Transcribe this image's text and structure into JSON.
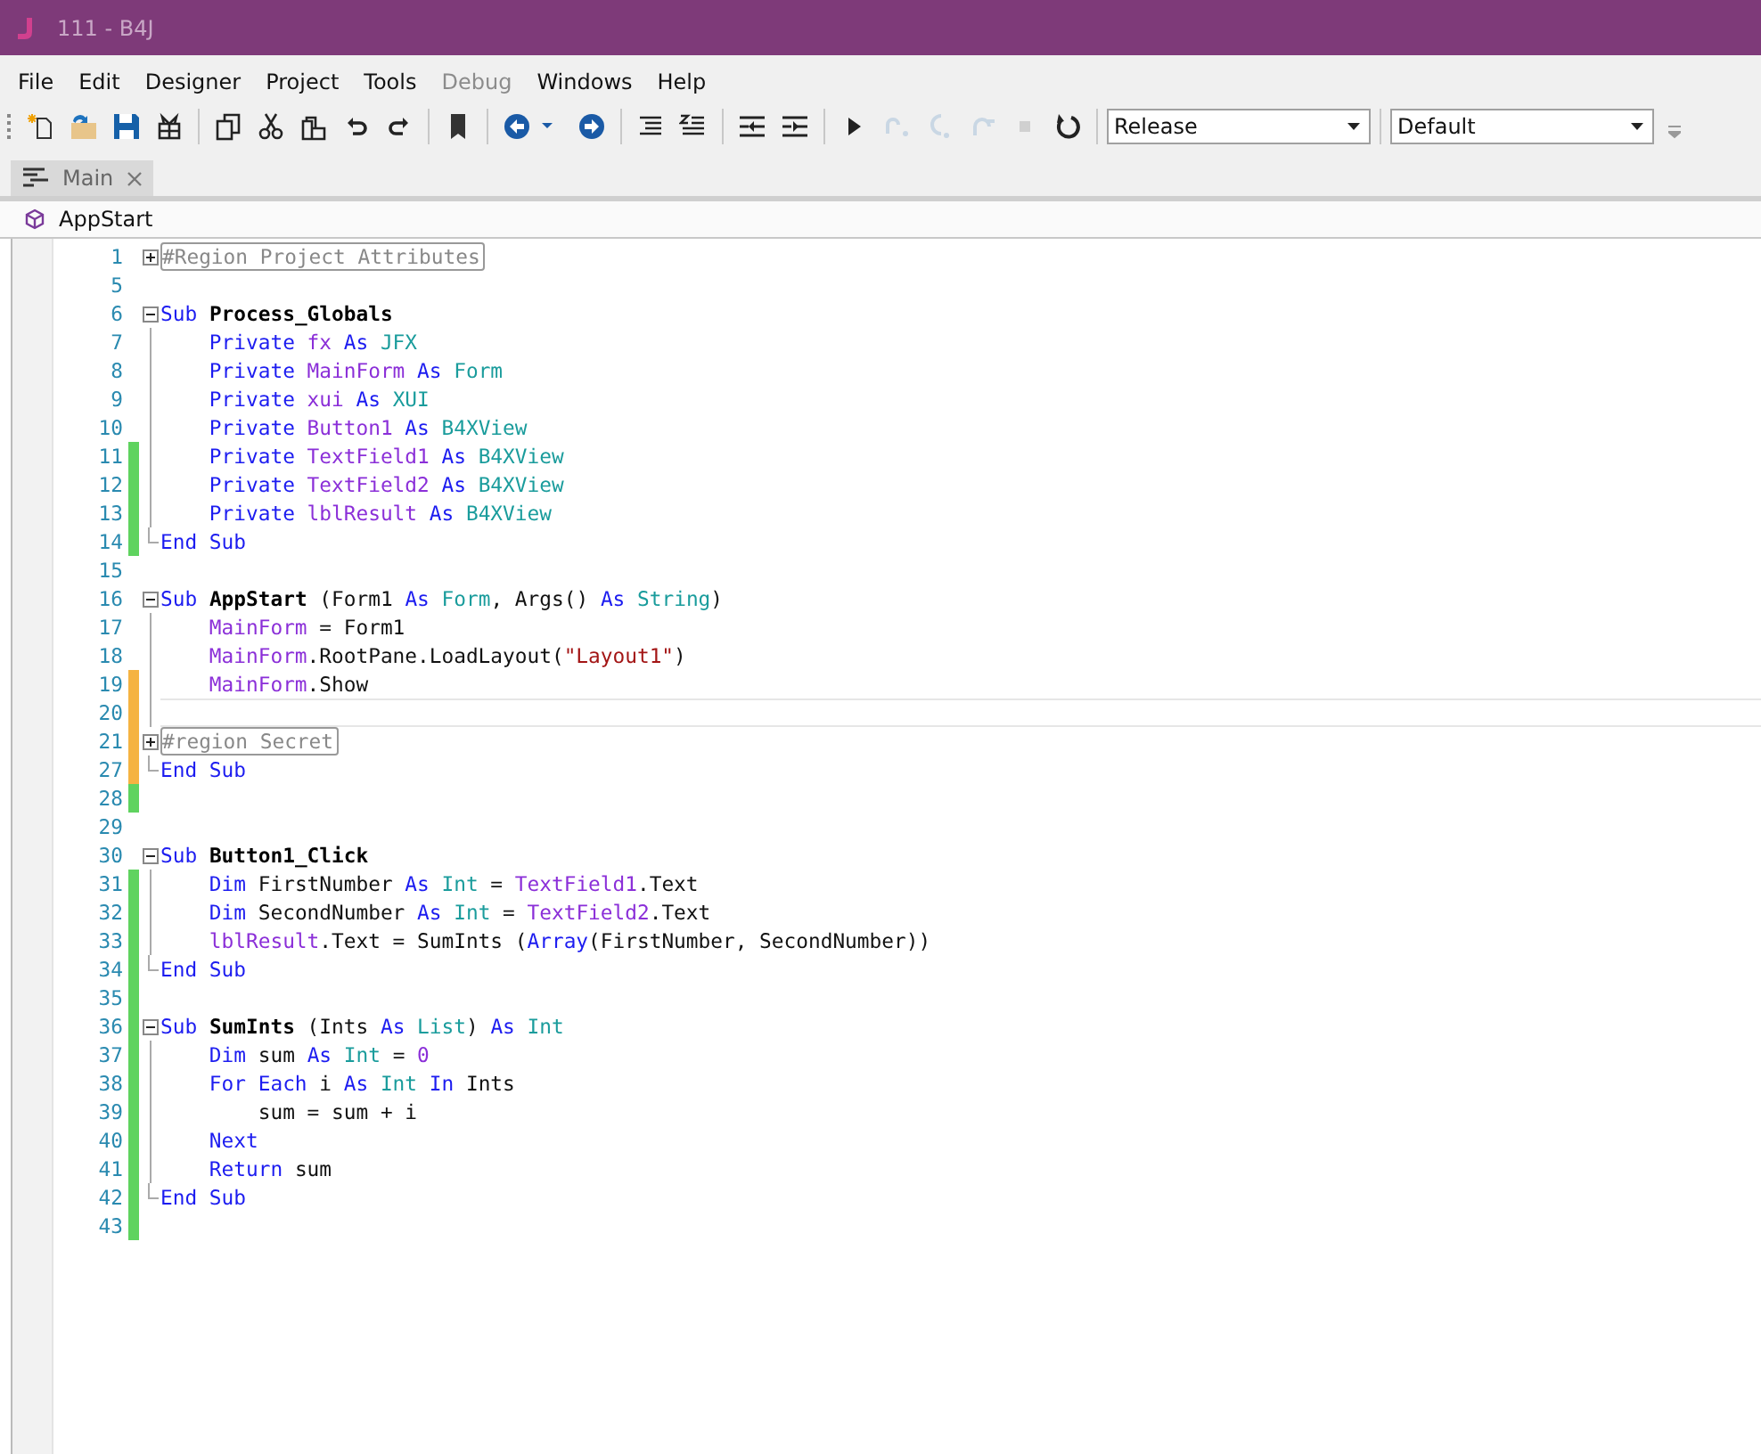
{
  "window": {
    "title": "111 - B4J"
  },
  "menu": [
    {
      "label": "File",
      "disabled": false
    },
    {
      "label": "Edit",
      "disabled": false
    },
    {
      "label": "Designer",
      "disabled": false
    },
    {
      "label": "Project",
      "disabled": false
    },
    {
      "label": "Tools",
      "disabled": false
    },
    {
      "label": "Debug",
      "disabled": true
    },
    {
      "label": "Windows",
      "disabled": false
    },
    {
      "label": "Help",
      "disabled": false
    }
  ],
  "toolbar": [
    {
      "kind": "new",
      "disabled": false
    },
    {
      "kind": "open",
      "disabled": false
    },
    {
      "kind": "save",
      "disabled": false
    },
    {
      "kind": "package",
      "disabled": false
    },
    {
      "kind": "sep"
    },
    {
      "kind": "copy",
      "disabled": false
    },
    {
      "kind": "cut",
      "disabled": false
    },
    {
      "kind": "paste",
      "disabled": false
    },
    {
      "kind": "undo",
      "disabled": false
    },
    {
      "kind": "redo",
      "disabled": false
    },
    {
      "kind": "sep"
    },
    {
      "kind": "bookmark",
      "disabled": false
    },
    {
      "kind": "sep"
    },
    {
      "kind": "back",
      "disabled": false
    },
    {
      "kind": "caret",
      "disabled": false
    },
    {
      "kind": "forward",
      "disabled": false
    },
    {
      "kind": "sep"
    },
    {
      "kind": "lines",
      "disabled": false
    },
    {
      "kind": "comment",
      "disabled": false
    },
    {
      "kind": "sep"
    },
    {
      "kind": "outdent",
      "disabled": false
    },
    {
      "kind": "indent",
      "disabled": false
    },
    {
      "kind": "sep"
    },
    {
      "kind": "run",
      "disabled": false
    },
    {
      "kind": "stepover",
      "disabled": true
    },
    {
      "kind": "stepinto",
      "disabled": true
    },
    {
      "kind": "stepout",
      "disabled": true
    },
    {
      "kind": "stop",
      "disabled": true
    },
    {
      "kind": "restart",
      "disabled": false
    }
  ],
  "selects": [
    {
      "value": "Release"
    },
    {
      "value": "Default"
    }
  ],
  "tabs": [
    {
      "label": "Main",
      "selected": true
    }
  ],
  "module_bar": {
    "label": "AppStart"
  },
  "lines": [
    {
      "n": "1",
      "kind": "closed",
      "current": false,
      "tokens": [
        {
          "kind": "region",
          "text": "#Region Project Attributes"
        }
      ]
    },
    {
      "n": "5",
      "kind": "plain",
      "current": false
    },
    {
      "n": "6",
      "kind": "open",
      "current": false,
      "tokens": [
        {
          "kind": "keyword",
          "text": "Sub "
        },
        {
          "kind": "name",
          "text": "Process_Globals"
        }
      ]
    },
    {
      "n": "7",
      "kind": "inside",
      "current": false,
      "tokens": [
        {
          "kind": "keyword",
          "text": "    Private "
        },
        {
          "kind": "variable",
          "text": "fx"
        },
        {
          "kind": "keyword",
          "text": " As "
        },
        {
          "kind": "type",
          "text": "JFX"
        }
      ]
    },
    {
      "n": "8",
      "kind": "inside",
      "current": false,
      "tokens": [
        {
          "kind": "keyword",
          "text": "    Private "
        },
        {
          "kind": "variable",
          "text": "MainForm"
        },
        {
          "kind": "keyword",
          "text": " As "
        },
        {
          "kind": "type",
          "text": "Form"
        }
      ]
    },
    {
      "n": "9",
      "kind": "inside",
      "current": false,
      "tokens": [
        {
          "kind": "keyword",
          "text": "    Private "
        },
        {
          "kind": "variable",
          "text": "xui"
        },
        {
          "kind": "keyword",
          "text": " As "
        },
        {
          "kind": "type",
          "text": "XUI"
        }
      ]
    },
    {
      "n": "10",
      "kind": "inside",
      "current": false,
      "tokens": [
        {
          "kind": "keyword",
          "text": "    Private "
        },
        {
          "kind": "variable",
          "text": "Button1"
        },
        {
          "kind": "keyword",
          "text": " As "
        },
        {
          "kind": "type",
          "text": "B4XView"
        }
      ]
    },
    {
      "n": "11",
      "kind": "inside",
      "color": "#5fd35f",
      "current": false,
      "tokens": [
        {
          "kind": "keyword",
          "text": "    Private "
        },
        {
          "kind": "variable",
          "text": "TextField1"
        },
        {
          "kind": "keyword",
          "text": " As "
        },
        {
          "kind": "type",
          "text": "B4XView"
        }
      ]
    },
    {
      "n": "12",
      "kind": "inside",
      "color": "#5fd35f",
      "current": false,
      "tokens": [
        {
          "kind": "keyword",
          "text": "    Private "
        },
        {
          "kind": "variable",
          "text": "TextField2"
        },
        {
          "kind": "keyword",
          "text": " As "
        },
        {
          "kind": "type",
          "text": "B4XView"
        }
      ]
    },
    {
      "n": "13",
      "kind": "inside",
      "color": "#5fd35f",
      "current": false,
      "tokens": [
        {
          "kind": "keyword",
          "text": "    Private "
        },
        {
          "kind": "variable",
          "text": "lblResult"
        },
        {
          "kind": "keyword",
          "text": " As "
        },
        {
          "kind": "type",
          "text": "B4XView"
        }
      ]
    },
    {
      "n": "14",
      "kind": "end",
      "color": "#5fd35f",
      "current": false,
      "tokens": [
        {
          "kind": "keyword",
          "text": "End Sub"
        }
      ]
    },
    {
      "n": "15",
      "kind": "plain",
      "current": false
    },
    {
      "n": "16",
      "kind": "open",
      "current": false,
      "tokens": [
        {
          "kind": "keyword",
          "text": "Sub "
        },
        {
          "kind": "name",
          "text": "AppStart"
        },
        {
          "kind": "plain",
          "text": " (Form1 "
        },
        {
          "kind": "keyword",
          "text": "As "
        },
        {
          "kind": "type",
          "text": "Form"
        },
        {
          "kind": "plain",
          "text": ", Args() "
        },
        {
          "kind": "keyword",
          "text": "As "
        },
        {
          "kind": "type",
          "text": "String"
        },
        {
          "kind": "plain",
          "text": ")"
        }
      ]
    },
    {
      "n": "17",
      "kind": "inside",
      "current": false,
      "tokens": [
        {
          "kind": "variable",
          "text": "    MainForm"
        },
        {
          "kind": "plain",
          "text": " = Form1"
        }
      ]
    },
    {
      "n": "18",
      "kind": "inside",
      "current": false,
      "tokens": [
        {
          "kind": "variable",
          "text": "    MainForm"
        },
        {
          "kind": "plain",
          "text": ".RootPane.LoadLayout("
        },
        {
          "kind": "string",
          "text": "\"Layout1\""
        },
        {
          "kind": "plain",
          "text": ")"
        }
      ]
    },
    {
      "n": "19",
      "kind": "inside",
      "color": "#f5b342",
      "current": false,
      "tokens": [
        {
          "kind": "variable",
          "text": "    MainForm"
        },
        {
          "kind": "plain",
          "text": ".Show"
        }
      ]
    },
    {
      "n": "20",
      "kind": "inside",
      "color": "#f5b342",
      "current": true
    },
    {
      "n": "21",
      "kind": "closed",
      "color": "#f5b342",
      "current": false,
      "tokens": [
        {
          "kind": "region",
          "text": "#region Secret"
        }
      ]
    },
    {
      "n": "27",
      "kind": "end",
      "color": "#f5b342",
      "current": false,
      "tokens": [
        {
          "kind": "keyword",
          "text": "End Sub"
        }
      ]
    },
    {
      "n": "28",
      "kind": "plain",
      "color": "#5fd35f",
      "current": false
    },
    {
      "n": "29",
      "kind": "plain",
      "current": false
    },
    {
      "n": "30",
      "kind": "open",
      "current": false,
      "tokens": [
        {
          "kind": "keyword",
          "text": "Sub "
        },
        {
          "kind": "name",
          "text": "Button1_Click"
        }
      ]
    },
    {
      "n": "31",
      "kind": "inside",
      "color": "#5fd35f",
      "current": false,
      "tokens": [
        {
          "kind": "keyword",
          "text": "    Dim "
        },
        {
          "kind": "plain",
          "text": "FirstNumber "
        },
        {
          "kind": "keyword",
          "text": "As "
        },
        {
          "kind": "type",
          "text": "Int"
        },
        {
          "kind": "plain",
          "text": " = "
        },
        {
          "kind": "variable",
          "text": "TextField1"
        },
        {
          "kind": "plain",
          "text": ".Text"
        }
      ]
    },
    {
      "n": "32",
      "kind": "inside",
      "color": "#5fd35f",
      "current": false,
      "tokens": [
        {
          "kind": "keyword",
          "text": "    Dim "
        },
        {
          "kind": "plain",
          "text": "SecondNumber "
        },
        {
          "kind": "keyword",
          "text": "As "
        },
        {
          "kind": "type",
          "text": "Int"
        },
        {
          "kind": "plain",
          "text": " = "
        },
        {
          "kind": "variable",
          "text": "TextField2"
        },
        {
          "kind": "plain",
          "text": ".Text"
        }
      ]
    },
    {
      "n": "33",
      "kind": "inside",
      "color": "#5fd35f",
      "current": false,
      "tokens": [
        {
          "kind": "variable",
          "text": "    lblResult"
        },
        {
          "kind": "plain",
          "text": ".Text = SumInts ("
        },
        {
          "kind": "keyword",
          "text": "Array"
        },
        {
          "kind": "plain",
          "text": "(FirstNumber, SecondNumber))"
        }
      ]
    },
    {
      "n": "34",
      "kind": "end",
      "color": "#5fd35f",
      "current": false,
      "tokens": [
        {
          "kind": "keyword",
          "text": "End Sub"
        }
      ]
    },
    {
      "n": "35",
      "kind": "plain",
      "color": "#5fd35f",
      "current": false
    },
    {
      "n": "36",
      "kind": "open",
      "color": "#5fd35f",
      "current": false,
      "tokens": [
        {
          "kind": "keyword",
          "text": "Sub "
        },
        {
          "kind": "name",
          "text": "SumInts"
        },
        {
          "kind": "plain",
          "text": " (Ints "
        },
        {
          "kind": "keyword",
          "text": "As "
        },
        {
          "kind": "type",
          "text": "List"
        },
        {
          "kind": "plain",
          "text": ") "
        },
        {
          "kind": "keyword",
          "text": "As "
        },
        {
          "kind": "type",
          "text": "Int"
        }
      ]
    },
    {
      "n": "37",
      "kind": "inside",
      "color": "#5fd35f",
      "current": false,
      "tokens": [
        {
          "kind": "keyword",
          "text": "    Dim "
        },
        {
          "kind": "plain",
          "text": "sum "
        },
        {
          "kind": "keyword",
          "text": "As "
        },
        {
          "kind": "type",
          "text": "Int"
        },
        {
          "kind": "plain",
          "text": " = "
        },
        {
          "kind": "number",
          "text": "0"
        }
      ]
    },
    {
      "n": "38",
      "kind": "inside",
      "color": "#5fd35f",
      "current": false,
      "tokens": [
        {
          "kind": "keyword",
          "text": "    For Each "
        },
        {
          "kind": "plain",
          "text": "i "
        },
        {
          "kind": "keyword",
          "text": "As "
        },
        {
          "kind": "type",
          "text": "Int "
        },
        {
          "kind": "keyword",
          "text": "In "
        },
        {
          "kind": "plain",
          "text": "Ints"
        }
      ]
    },
    {
      "n": "39",
      "kind": "inside",
      "color": "#5fd35f",
      "current": false,
      "tokens": [
        {
          "kind": "plain",
          "text": "        sum = sum + i"
        }
      ]
    },
    {
      "n": "40",
      "kind": "inside",
      "color": "#5fd35f",
      "current": false,
      "tokens": [
        {
          "kind": "keyword",
          "text": "    Next"
        }
      ]
    },
    {
      "n": "41",
      "kind": "inside",
      "color": "#5fd35f",
      "current": false,
      "tokens": [
        {
          "kind": "keyword",
          "text": "    Return "
        },
        {
          "kind": "plain",
          "text": "sum"
        }
      ]
    },
    {
      "n": "42",
      "kind": "end",
      "color": "#5fd35f",
      "current": false,
      "tokens": [
        {
          "kind": "keyword",
          "text": "End Sub"
        }
      ]
    },
    {
      "n": "43",
      "kind": "plain",
      "color": "#5fd35f",
      "current": false
    }
  ]
}
